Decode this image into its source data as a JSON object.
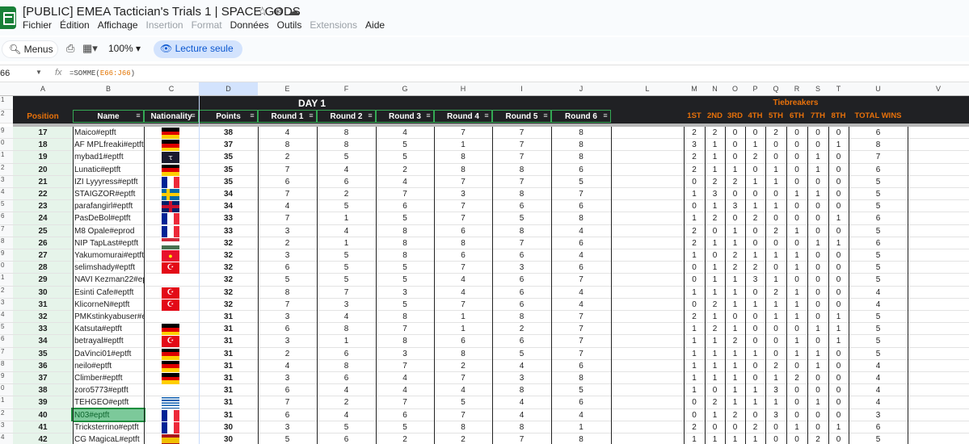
{
  "app": {
    "title": "[PUBLIC] EMEA Tactician's Trials 1 | SPACE GODS",
    "menus": [
      "Fichier",
      "Édition",
      "Affichage",
      "Insertion",
      "Format",
      "Données",
      "Outils",
      "Extensions",
      "Aide"
    ],
    "disabled": [
      "Insertion",
      "Format",
      "Extensions"
    ]
  },
  "toolbar": {
    "menus_label": "Menus",
    "zoom": "100%",
    "readonly_label": "Lecture seule"
  },
  "formula_bar": {
    "cell_ref": "66",
    "fx": "fx",
    "formula_prefix": "=SOMME(",
    "formula_range": "E66:J66",
    "formula_suffix": ")"
  },
  "columns": [
    "A",
    "B",
    "C",
    "D",
    "E",
    "F",
    "G",
    "H",
    "I",
    "J",
    "L",
    "M",
    "N",
    "O",
    "P",
    "Q",
    "R",
    "S",
    "T",
    "U",
    "V"
  ],
  "header": {
    "day": "DAY 1",
    "tiebreakers": "Tiebreakers",
    "cols": [
      "Position",
      "Name",
      "Nationality",
      "Points",
      "Round 1",
      "Round 2",
      "Round 3",
      "Round 4",
      "Round 5",
      "Round 6"
    ],
    "tb_cols": [
      "1ST",
      "2ND",
      "3RD",
      "4TH",
      "5TH",
      "6TH",
      "7TH",
      "8TH",
      "TOTAL WINS"
    ],
    "row_nums": [
      "1",
      "2"
    ]
  },
  "colors": {
    "accent": "#e8710a",
    "header_bg": "#202124",
    "pos_bg": "#e6f4ea",
    "selected": "#34a853"
  },
  "rows": [
    {
      "rn": "9",
      "pos": "17",
      "name": "Maico#eptft",
      "flag": "de",
      "pts": "38",
      "r": [
        "4",
        "8",
        "4",
        "7",
        "7",
        "8"
      ],
      "tb": [
        "2",
        "2",
        "0",
        "0",
        "2",
        "0",
        "0",
        "0"
      ],
      "tw": "6"
    },
    {
      "rn": "0",
      "pos": "18",
      "name": "AF MPLfreaki#eptft",
      "flag": "de",
      "pts": "37",
      "r": [
        "8",
        "8",
        "5",
        "1",
        "7",
        "8"
      ],
      "tb": [
        "3",
        "1",
        "0",
        "1",
        "0",
        "0",
        "0",
        "1"
      ],
      "tw": "8"
    },
    {
      "rn": "1",
      "pos": "19",
      "name": "mybad1#eptft",
      "flag": "other",
      "pts": "35",
      "r": [
        "2",
        "5",
        "5",
        "8",
        "7",
        "8"
      ],
      "tb": [
        "2",
        "1",
        "0",
        "2",
        "0",
        "0",
        "1",
        "0"
      ],
      "tw": "7"
    },
    {
      "rn": "2",
      "pos": "20",
      "name": "Lunatic#eptft",
      "flag": "de",
      "pts": "35",
      "r": [
        "7",
        "4",
        "2",
        "8",
        "8",
        "6"
      ],
      "tb": [
        "2",
        "1",
        "1",
        "0",
        "1",
        "0",
        "1",
        "0"
      ],
      "tw": "6"
    },
    {
      "rn": "3",
      "pos": "21",
      "name": "IZI Lyyyress#eptft",
      "flag": "fr",
      "pts": "35",
      "r": [
        "6",
        "6",
        "4",
        "7",
        "7",
        "5"
      ],
      "tb": [
        "0",
        "2",
        "2",
        "1",
        "1",
        "0",
        "0",
        "0"
      ],
      "tw": "5"
    },
    {
      "rn": "4",
      "pos": "22",
      "name": "STAIGZOR#eptft",
      "flag": "se",
      "pts": "34",
      "r": [
        "7",
        "2",
        "7",
        "3",
        "8",
        "7"
      ],
      "tb": [
        "1",
        "3",
        "0",
        "0",
        "0",
        "1",
        "1",
        "0"
      ],
      "tw": "5"
    },
    {
      "rn": "5",
      "pos": "23",
      "name": "parafangirl#eptft",
      "flag": "gb",
      "pts": "34",
      "r": [
        "4",
        "5",
        "6",
        "7",
        "6",
        "6"
      ],
      "tb": [
        "0",
        "1",
        "3",
        "1",
        "1",
        "0",
        "0",
        "0"
      ],
      "tw": "5"
    },
    {
      "rn": "6",
      "pos": "24",
      "name": "PasDeBol#eptft",
      "flag": "fr",
      "pts": "33",
      "r": [
        "7",
        "1",
        "5",
        "7",
        "5",
        "8"
      ],
      "tb": [
        "1",
        "2",
        "0",
        "2",
        "0",
        "0",
        "0",
        "1"
      ],
      "tw": "6"
    },
    {
      "rn": "7",
      "pos": "25",
      "name": "M8 Opale#eprod",
      "flag": "fr",
      "pts": "33",
      "r": [
        "3",
        "4",
        "8",
        "6",
        "8",
        "4"
      ],
      "tb": [
        "2",
        "0",
        "1",
        "0",
        "2",
        "1",
        "0",
        "0"
      ],
      "tw": "5"
    },
    {
      "rn": "8",
      "pos": "26",
      "name": "NIP TapLast#eptft",
      "flag": "hu",
      "pts": "32",
      "r": [
        "2",
        "1",
        "8",
        "8",
        "7",
        "6"
      ],
      "tb": [
        "2",
        "1",
        "1",
        "0",
        "0",
        "0",
        "1",
        "1"
      ],
      "tw": "6"
    },
    {
      "rn": "9",
      "pos": "27",
      "name": "Yakumomurai#eptft",
      "flag": "kg",
      "pts": "32",
      "r": [
        "3",
        "5",
        "8",
        "6",
        "6",
        "4"
      ],
      "tb": [
        "1",
        "0",
        "2",
        "1",
        "1",
        "1",
        "0",
        "0"
      ],
      "tw": "5"
    },
    {
      "rn": "0",
      "pos": "28",
      "name": "selimshady#eptft",
      "flag": "tr",
      "pts": "32",
      "r": [
        "6",
        "5",
        "5",
        "7",
        "3",
        "6"
      ],
      "tb": [
        "0",
        "1",
        "2",
        "2",
        "0",
        "1",
        "0",
        "0"
      ],
      "tw": "5"
    },
    {
      "rn": "1",
      "pos": "29",
      "name": "NAVI Kezman22#ep",
      "flag": "none",
      "pts": "32",
      "r": [
        "5",
        "5",
        "5",
        "4",
        "6",
        "7"
      ],
      "tb": [
        "0",
        "1",
        "1",
        "3",
        "1",
        "0",
        "0",
        "0"
      ],
      "tw": "5"
    },
    {
      "rn": "2",
      "pos": "30",
      "name": "Esinti Cafe#eptft",
      "flag": "tr",
      "pts": "32",
      "r": [
        "8",
        "7",
        "3",
        "4",
        "6",
        "4"
      ],
      "tb": [
        "1",
        "1",
        "1",
        "0",
        "2",
        "1",
        "0",
        "0"
      ],
      "tw": "4"
    },
    {
      "rn": "3",
      "pos": "31",
      "name": "KlicorneN#eptft",
      "flag": "tr",
      "pts": "32",
      "r": [
        "7",
        "3",
        "5",
        "7",
        "6",
        "4"
      ],
      "tb": [
        "0",
        "2",
        "1",
        "1",
        "1",
        "1",
        "0",
        "0"
      ],
      "tw": "4"
    },
    {
      "rn": "4",
      "pos": "32",
      "name": "PMKstinkyabuser#e",
      "flag": "none",
      "pts": "31",
      "r": [
        "3",
        "4",
        "8",
        "1",
        "8",
        "7"
      ],
      "tb": [
        "2",
        "1",
        "0",
        "0",
        "1",
        "1",
        "0",
        "1"
      ],
      "tw": "5"
    },
    {
      "rn": "5",
      "pos": "33",
      "name": "Katsuta#eptft",
      "flag": "de",
      "pts": "31",
      "r": [
        "6",
        "8",
        "7",
        "1",
        "2",
        "7"
      ],
      "tb": [
        "1",
        "2",
        "1",
        "0",
        "0",
        "0",
        "1",
        "1"
      ],
      "tw": "5"
    },
    {
      "rn": "6",
      "pos": "34",
      "name": "betrayal#eptft",
      "flag": "tr",
      "pts": "31",
      "r": [
        "3",
        "1",
        "8",
        "6",
        "6",
        "7"
      ],
      "tb": [
        "1",
        "1",
        "2",
        "0",
        "0",
        "1",
        "0",
        "1"
      ],
      "tw": "5"
    },
    {
      "rn": "7",
      "pos": "35",
      "name": "DaVinci01#eptft",
      "flag": "de",
      "pts": "31",
      "r": [
        "2",
        "6",
        "3",
        "8",
        "5",
        "7"
      ],
      "tb": [
        "1",
        "1",
        "1",
        "1",
        "0",
        "1",
        "1",
        "0"
      ],
      "tw": "5"
    },
    {
      "rn": "8",
      "pos": "36",
      "name": "neilo#eptft",
      "flag": "de",
      "pts": "31",
      "r": [
        "4",
        "8",
        "7",
        "2",
        "4",
        "6"
      ],
      "tb": [
        "1",
        "1",
        "1",
        "0",
        "2",
        "0",
        "1",
        "0"
      ],
      "tw": "4"
    },
    {
      "rn": "9",
      "pos": "37",
      "name": "Climber#eptft",
      "flag": "de",
      "pts": "31",
      "r": [
        "3",
        "6",
        "4",
        "7",
        "3",
        "8"
      ],
      "tb": [
        "1",
        "1",
        "1",
        "0",
        "1",
        "2",
        "0",
        "0"
      ],
      "tw": "4"
    },
    {
      "rn": "0",
      "pos": "38",
      "name": "zoro5773#eptft",
      "flag": "none",
      "pts": "31",
      "r": [
        "6",
        "4",
        "4",
        "4",
        "8",
        "5"
      ],
      "tb": [
        "1",
        "0",
        "1",
        "1",
        "3",
        "0",
        "0",
        "0"
      ],
      "tw": "4"
    },
    {
      "rn": "1",
      "pos": "39",
      "name": "TEHGEO#eptft",
      "flag": "gr",
      "pts": "31",
      "r": [
        "7",
        "2",
        "7",
        "5",
        "4",
        "6"
      ],
      "tb": [
        "0",
        "2",
        "1",
        "1",
        "1",
        "0",
        "1",
        "0"
      ],
      "tw": "4"
    },
    {
      "rn": "2",
      "pos": "40",
      "name": "N03#eptft",
      "flag": "fr",
      "pts": "31",
      "r": [
        "6",
        "4",
        "6",
        "7",
        "4",
        "4"
      ],
      "tb": [
        "0",
        "1",
        "2",
        "0",
        "3",
        "0",
        "0",
        "0"
      ],
      "tw": "3"
    },
    {
      "rn": "3",
      "pos": "41",
      "name": "Tricksterrino#eptft",
      "flag": "fr",
      "pts": "30",
      "r": [
        "3",
        "5",
        "5",
        "8",
        "8",
        "1"
      ],
      "tb": [
        "2",
        "0",
        "0",
        "2",
        "0",
        "1",
        "0",
        "1"
      ],
      "tw": "6"
    },
    {
      "rn": "4",
      "pos": "42",
      "name": "CG MagicaL#eptft",
      "flag": "es",
      "pts": "30",
      "r": [
        "5",
        "6",
        "2",
        "2",
        "7",
        "8"
      ],
      "tb": [
        "1",
        "1",
        "1",
        "1",
        "0",
        "0",
        "2",
        "0"
      ],
      "tw": "5"
    }
  ]
}
